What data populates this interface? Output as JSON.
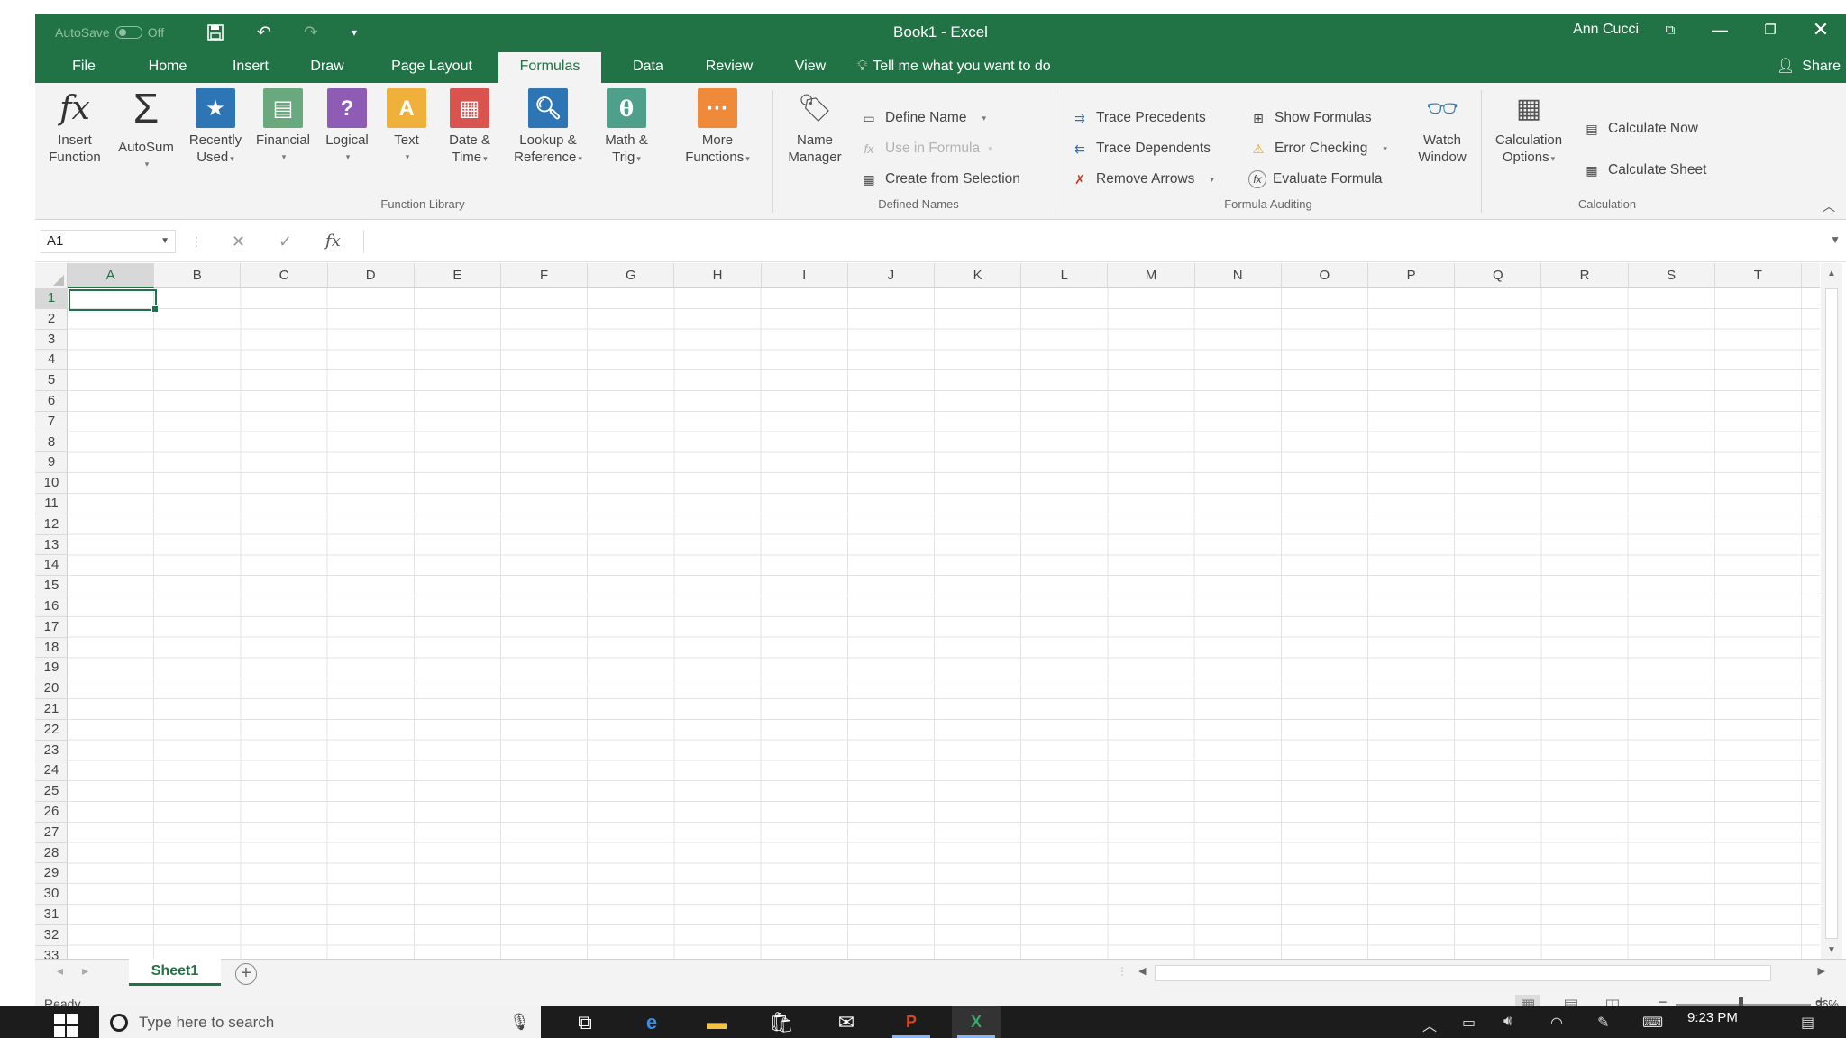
{
  "title_bar": {
    "autosave_label": "AutoSave",
    "autosave_state": "Off",
    "document_title": "Book1  -  Excel",
    "user_name": "Ann Cucci"
  },
  "tabs": [
    {
      "label": "File",
      "active": false
    },
    {
      "label": "Home",
      "active": false
    },
    {
      "label": "Insert",
      "active": false
    },
    {
      "label": "Draw",
      "active": false
    },
    {
      "label": "Page Layout",
      "active": false
    },
    {
      "label": "Formulas",
      "active": true
    },
    {
      "label": "Data",
      "active": false
    },
    {
      "label": "Review",
      "active": false
    },
    {
      "label": "View",
      "active": false
    }
  ],
  "tell_me": "Tell me what you want to do",
  "share_label": "Share",
  "ribbon": {
    "function_library": {
      "label": "Function Library",
      "insert_function": [
        "Insert",
        "Function"
      ],
      "autosum": "AutoSum",
      "recently_used": [
        "Recently",
        "Used"
      ],
      "financial": "Financial",
      "logical": "Logical",
      "text": "Text",
      "date_time": [
        "Date &",
        "Time"
      ],
      "lookup_reference": [
        "Lookup &",
        "Reference"
      ],
      "math_trig": [
        "Math &",
        "Trig"
      ],
      "more_functions": [
        "More",
        "Functions"
      ]
    },
    "defined_names": {
      "label": "Defined Names",
      "name_manager": [
        "Name",
        "Manager"
      ],
      "define_name": "Define Name",
      "use_in_formula": "Use in Formula",
      "create_from_selection": "Create from Selection"
    },
    "formula_auditing": {
      "label": "Formula Auditing",
      "trace_precedents": "Trace Precedents",
      "trace_dependents": "Trace Dependents",
      "remove_arrows": "Remove Arrows",
      "show_formulas": "Show Formulas",
      "error_checking": "Error Checking",
      "evaluate_formula": "Evaluate Formula",
      "watch_window": [
        "Watch",
        "Window"
      ]
    },
    "calculation": {
      "label": "Calculation",
      "calculation_options": [
        "Calculation",
        "Options"
      ],
      "calculate_now": "Calculate Now",
      "calculate_sheet": "Calculate Sheet"
    }
  },
  "formula_bar": {
    "name_box": "A1",
    "fx": "fx",
    "value": ""
  },
  "grid": {
    "columns": [
      "A",
      "B",
      "C",
      "D",
      "E",
      "F",
      "G",
      "H",
      "I",
      "J",
      "K",
      "L",
      "M",
      "N",
      "O",
      "P",
      "Q",
      "R",
      "S",
      "T"
    ],
    "rows": [
      "1",
      "2",
      "3",
      "4",
      "5",
      "6",
      "7",
      "8",
      "9",
      "10",
      "11",
      "12",
      "13",
      "14",
      "15",
      "16",
      "17",
      "18",
      "19",
      "20",
      "21",
      "22",
      "23",
      "24",
      "25",
      "26",
      "27",
      "28",
      "29",
      "30",
      "31",
      "32",
      "33"
    ],
    "active_cell": "A1"
  },
  "sheets": [
    {
      "label": "Sheet1",
      "active": true
    }
  ],
  "status": {
    "text": "Ready",
    "zoom_level": "96%",
    "zoom_value": 96
  },
  "taskbar": {
    "search_placeholder": "Type here to search",
    "time": "9:23 PM",
    "apps": [
      "task-view-icon",
      "edge-icon",
      "file-explorer-icon",
      "store-icon",
      "mail-icon",
      "powerpoint-icon",
      "excel-icon"
    ]
  }
}
